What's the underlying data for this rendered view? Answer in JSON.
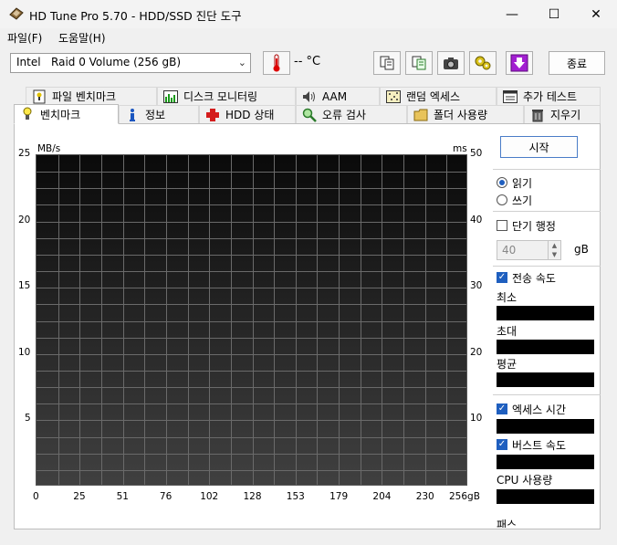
{
  "window": {
    "title": "HD Tune Pro 5.70 - HDD/SSD 진단 도구",
    "minimize": "—",
    "maximize": "☐",
    "close": "✕"
  },
  "menu": [
    {
      "label": "파일(F)"
    },
    {
      "label": "도움말(H)"
    }
  ],
  "toolbar": {
    "drive": "Intel   Raid 0 Volume (256 gB)",
    "temperature": "-- °C",
    "exit_label": "종료"
  },
  "tabs_top": [
    {
      "label": "파일 벤치마크",
      "icon": "file-benchmark-icon"
    },
    {
      "label": "디스크 모니터링",
      "icon": "disk-monitor-icon"
    },
    {
      "label": "AAM",
      "icon": "speaker-icon"
    },
    {
      "label": "랜덤 엑세스",
      "icon": "random-access-icon"
    },
    {
      "label": "추가 테스트",
      "icon": "extra-tests-icon"
    }
  ],
  "tabs_bottom": [
    {
      "label": "벤치마크",
      "icon": "benchmark-icon",
      "active": true
    },
    {
      "label": "정보",
      "icon": "info-icon"
    },
    {
      "label": "HDD 상태",
      "icon": "health-cross-icon"
    },
    {
      "label": "오류 검사",
      "icon": "error-scan-icon"
    },
    {
      "label": "폴더 사용량",
      "icon": "folder-icon"
    },
    {
      "label": "지우기",
      "icon": "trash-icon"
    }
  ],
  "chart_data": {
    "type": "line",
    "title": "",
    "xlabel": "",
    "ylabel": "MB/s",
    "y2label": "ms",
    "x_ticks": [
      "0",
      "25",
      "51",
      "76",
      "102",
      "128",
      "153",
      "179",
      "204",
      "230",
      "256gB"
    ],
    "y_ticks": [
      "25",
      "20",
      "15",
      "10",
      "5"
    ],
    "y2_ticks": [
      "50",
      "40",
      "30",
      "20",
      "10"
    ],
    "ylim": [
      0,
      25
    ],
    "y2lim": [
      0,
      50
    ],
    "xlim": [
      0,
      256
    ],
    "grid": true,
    "series": []
  },
  "controls": {
    "start_label": "시작",
    "read_label": "읽기",
    "write_label": "쓰기",
    "short_stroke_label": "단기 행정",
    "short_stroke_value": "40",
    "unit_gb": "gB",
    "transfer_rate_label": "전송 속도",
    "min_label": "최소",
    "max_label": "초대",
    "avg_label": "평균",
    "access_time_label": "엑세스 시간",
    "burst_rate_label": "버스트 속도",
    "cpu_label": "CPU 사용량",
    "pass_label": "패스"
  },
  "colors": {
    "accent": "#1f5fbf",
    "graph_bg": "#1a1a1a",
    "grid": "#6a6a6a"
  }
}
